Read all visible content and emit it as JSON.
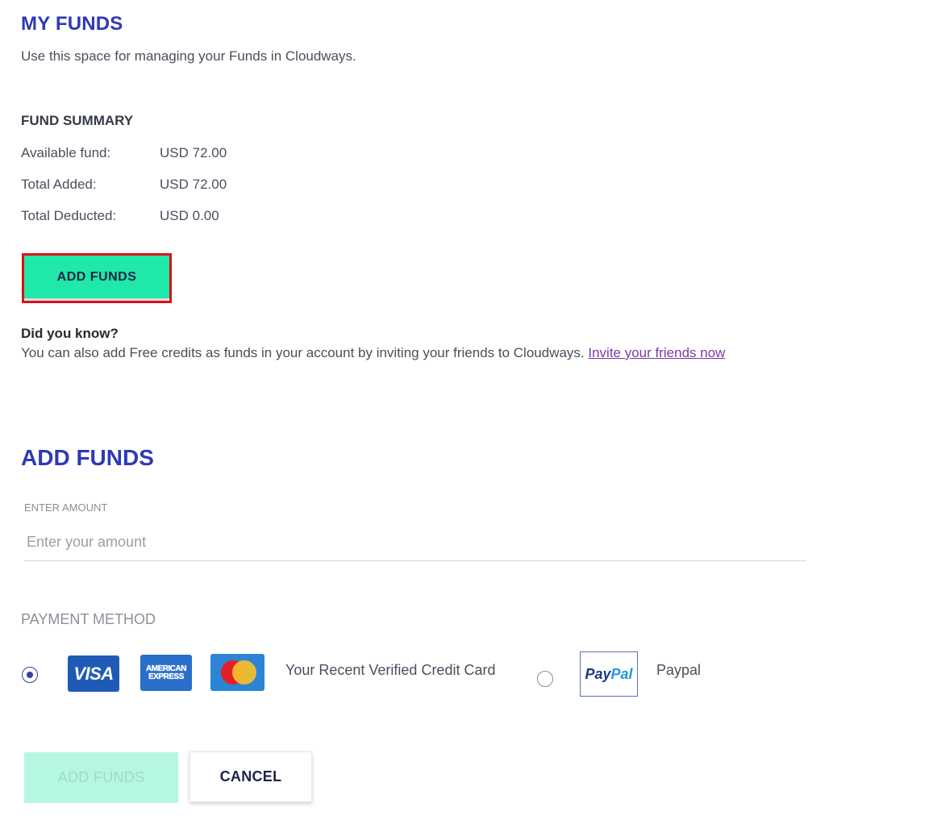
{
  "my_funds": {
    "title": "MY FUNDS",
    "subtitle": "Use this space for managing your Funds in Cloudways."
  },
  "fund_summary": {
    "heading": "FUND SUMMARY",
    "rows": [
      {
        "label": "Available fund:",
        "value": "USD 72.00"
      },
      {
        "label": "Total Added:",
        "value": "USD 72.00"
      },
      {
        "label": "Total Deducted:",
        "value": "USD 0.00"
      }
    ],
    "add_funds_button": "ADD FUNDS",
    "highlight_color": "#e0121b",
    "button_color": "#1fe8a8"
  },
  "did_you_know": {
    "heading": "Did you know?",
    "text": "You can also add Free credits as funds in your account by inviting your friends to Cloudways. ",
    "link": "Invite your friends now"
  },
  "add_funds_form": {
    "title": "ADD FUNDS",
    "amount_label": "ENTER AMOUNT",
    "amount_value": "",
    "amount_placeholder": "Enter your amount",
    "payment_method_label": "PAYMENT METHOD",
    "payment_options": [
      {
        "label": "Your Recent Verified Credit Card",
        "selected": true,
        "icons": [
          "visa-card-icon",
          "amex-card-icon",
          "mastercard-icon"
        ]
      },
      {
        "label": "Paypal",
        "selected": false,
        "icons": [
          "paypal-icon"
        ]
      }
    ],
    "card_logos": {
      "visa": "VISA",
      "amex_line1": "AMERICAN",
      "amex_line2": "EXPRESS",
      "paypal_pay": "Pay",
      "paypal_pal": "Pal"
    },
    "submit_button": "ADD FUNDS",
    "cancel_button": "CANCEL"
  },
  "colors": {
    "heading_blue": "#2e3ab5",
    "link_purple": "#7b3aa8",
    "disabled_button": "#b5f7e2"
  }
}
